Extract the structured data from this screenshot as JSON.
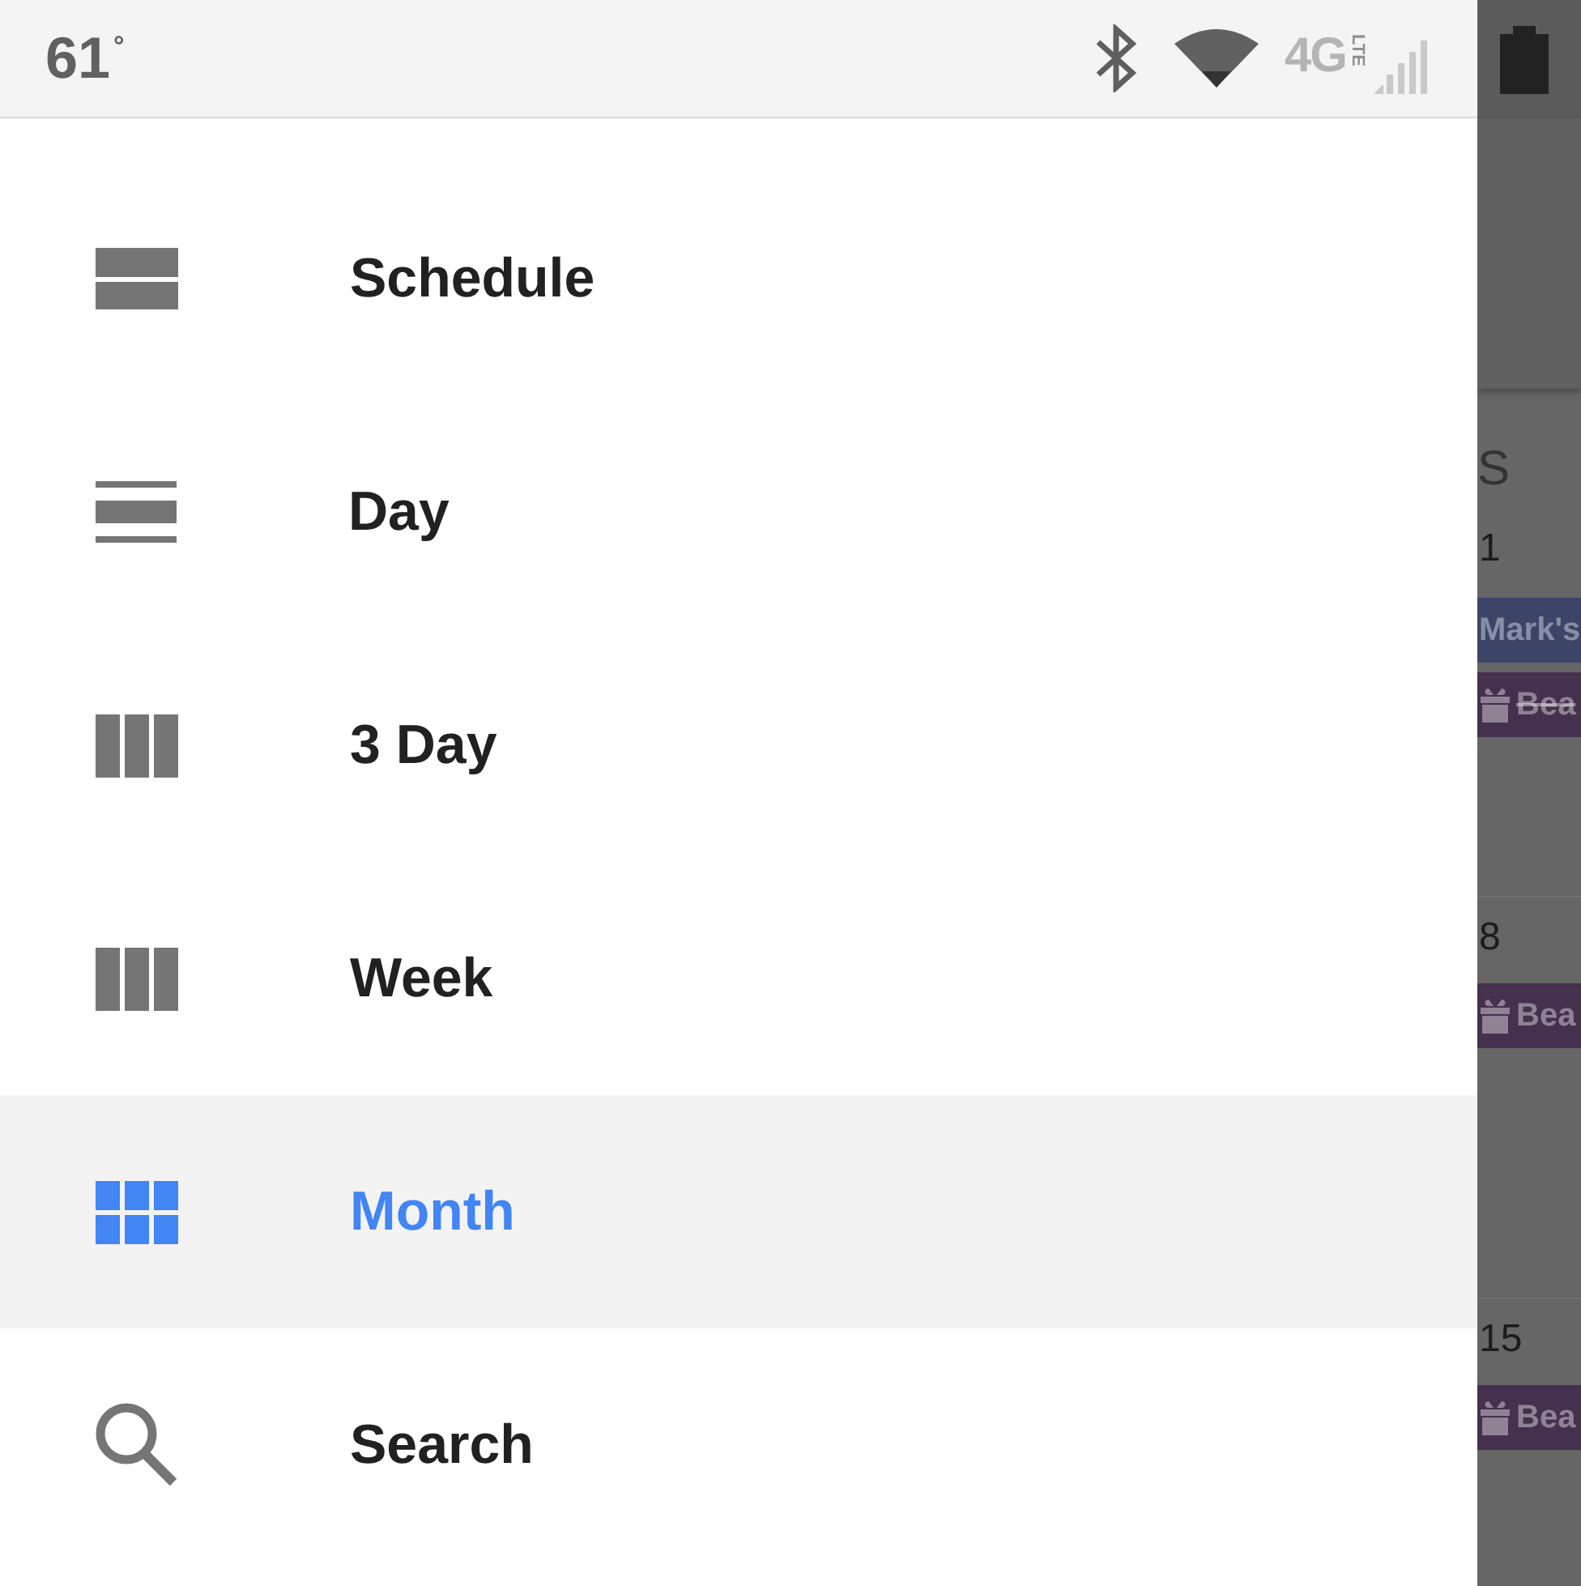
{
  "status_bar": {
    "temperature": "61$^{°}$",
    "network": "4G",
    "network_sub": "LTE"
  },
  "drawer": {
    "items": [
      {
        "kind": "schedule",
        "label": "Schedule",
        "selected": false
      },
      {
        "kind": "day",
        "label": "Day",
        "selected": false
      },
      {
        "kind": "three_day",
        "label": "3 Day",
        "selected": false
      },
      {
        "kind": "week",
        "label": "Week",
        "selected": false
      },
      {
        "kind": "month",
        "label": "Month",
        "selected": true
      },
      {
        "kind": "search",
        "label": "Search",
        "selected": false
      }
    ]
  },
  "calendar": {
    "weekday": "S",
    "weeks": [
      {
        "date": "1",
        "events": [
          {
            "kind": "plain",
            "title": "Mark's",
            "color": "#3c4468",
            "declined": false
          },
          {
            "kind": "gift",
            "title": "Bea",
            "color": "#45304e",
            "declined": true
          }
        ]
      },
      {
        "date": "8",
        "events": [
          {
            "kind": "gift",
            "title": "Bea",
            "color": "#45304e",
            "declined": false
          }
        ]
      },
      {
        "date": "15",
        "events": [
          {
            "kind": "gift",
            "title": "Bea",
            "color": "#45304e",
            "declined": false
          }
        ]
      }
    ]
  }
}
